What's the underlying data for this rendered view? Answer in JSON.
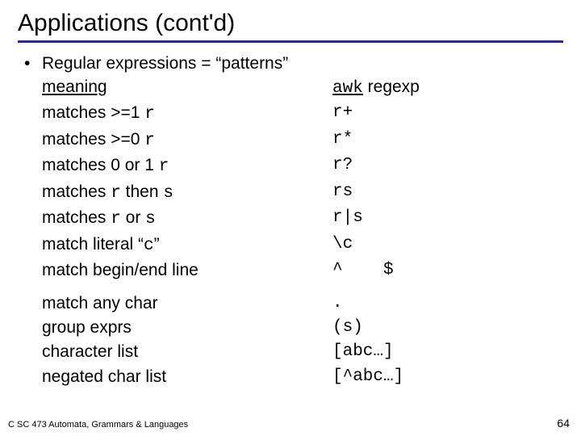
{
  "title": "Applications (cont'd)",
  "bullet": "Regular expressions = “patterns”",
  "header": {
    "left": "meaning",
    "right_u": "awk",
    "right_rest": " regexp"
  },
  "rows": [
    {
      "l_pre": "matches >=1 ",
      "l_code": "r",
      "l_post": "",
      "r": "r+"
    },
    {
      "l_pre": "matches >=0 ",
      "l_code": "r",
      "l_post": "",
      "r": "r*"
    },
    {
      "l_pre": "matches 0 or 1 ",
      "l_code": "r",
      "l_post": "",
      "r": "r?"
    },
    {
      "l_pre": "matches ",
      "l_code": "r",
      "l_mid": " then ",
      "l_code2": "s",
      "r": "rs"
    },
    {
      "l_pre": "matches ",
      "l_code": "r",
      "l_mid": " or ",
      "l_code2": "s",
      "r": "r|s"
    },
    {
      "l_pre": "match literal “",
      "l_code": "c",
      "l_post": "”",
      "r": "\\c"
    },
    {
      "l_pre": "match begin/end line",
      "r": "^    $"
    }
  ],
  "rows2": [
    {
      "l": "match any char",
      "r": "."
    },
    {
      "l": "group exprs",
      "r": "(s)"
    },
    {
      "l": "character list",
      "r": "[abc…]"
    },
    {
      "l": "negated char list",
      "r": "[^abc…]"
    }
  ],
  "footer": {
    "left": "C SC 473 Automata, Grammars & Languages",
    "right": "64"
  }
}
